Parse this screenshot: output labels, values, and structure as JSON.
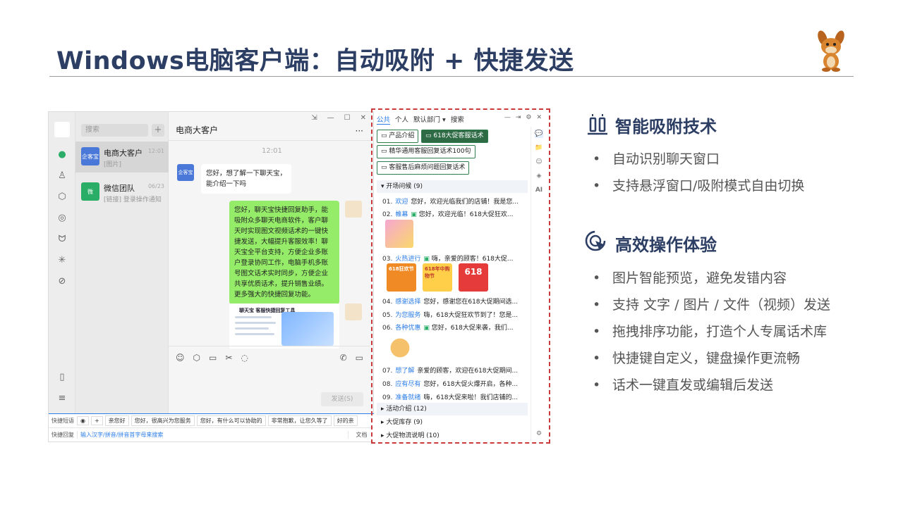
{
  "title": "Windows电脑客户端：自动吸附 + 快捷发送",
  "chat_window": {
    "search_placeholder": "搜索",
    "plus": "+",
    "conversations": [
      {
        "avatar": "企客宝",
        "name": "电商大客户",
        "time": "12:01",
        "preview": "[图片]",
        "color": "#4a78d8"
      },
      {
        "avatar": "微",
        "name": "微信团队",
        "time": "06/23",
        "preview": "[链接] 登录操作通知",
        "color": "#2aae67"
      }
    ],
    "header_title": "电商大客户",
    "more": "···",
    "window_buttons": [
      "⇲",
      "—",
      "☐",
      "✕"
    ],
    "timestamp": "12:01",
    "incoming_avatar": "企客宝",
    "incoming_message": "您好，想了解一下聊天宝，能介绍一下吗",
    "outgoing_message": "您好，聊天宝快捷回复助手，能吸附众多聊天电商软件，客户聊天时实现图文视频话术的一键快捷发送，大幅提升客服效率！聊天宝全平台支持，方便企业多账户登录协同工作，电脑手机多账号图文话术实时同步，方便企业共享优质话术，提升销售业绩。更多强大的快捷回复功能。",
    "image_message_title": "聊天宝 客服快捷回复工具",
    "send_button": "发送(S)",
    "quickbar_label": "快捷短语",
    "quick_chips": [
      "亲您好",
      "您好，很高兴为您服务",
      "您好，有什么可以协助的",
      "非常抱歉，让您久等了",
      "好的亲"
    ],
    "quickreply_label": "快捷回复",
    "quickreply_placeholder": "输入汉字/拼音/拼音首字母来搜索",
    "doc_button": "文档"
  },
  "panel": {
    "tabs": [
      "公共",
      "个人",
      "默认部门 ▾",
      "搜索"
    ],
    "active_tab": "公共",
    "folders": [
      "产品介绍",
      "618大促客服话术",
      "精华通用客服回复话术100句",
      "客服售后麻烦问题回复话术"
    ],
    "group_open": "开场问候  (9)",
    "rows": [
      {
        "num": "01.",
        "key": "欢迎",
        "text": "您好，欢迎光临我们的店铺！我是您..."
      },
      {
        "num": "02.",
        "key": "帷幕",
        "text": "您好，欢迎光临！618大促狂欢..."
      },
      {
        "num": "03.",
        "key": "火热进行",
        "text": "嗨，亲爱的顾客！618大促..."
      },
      {
        "num": "04.",
        "key": "感谢选择",
        "text": "您好，感谢您在618大促期间选..."
      },
      {
        "num": "05.",
        "key": "为您服务",
        "text": "嗨，618大促狂欢节到了！您是..."
      },
      {
        "num": "06.",
        "key": "各种优惠",
        "text": "您好，618大促来袭，我们..."
      },
      {
        "num": "07.",
        "key": "想了解",
        "text": "亲爱的顾客，欢迎在618大促期间..."
      },
      {
        "num": "08.",
        "key": "应有尽有",
        "text": "您好，618大促火爆开启，各种..."
      },
      {
        "num": "09.",
        "key": "准备就绪",
        "text": "嗨，618大促来啦！我们店铺的..."
      }
    ],
    "thumb_labels": [
      "618狂欢节",
      "618年中购物节",
      "618"
    ],
    "groups_closed": [
      "活动介绍  (12)",
      "大促库存  (9)",
      "大促物流说明  (10)"
    ],
    "side_icons": [
      "💬",
      "📁",
      "☺",
      "◈",
      "AI",
      "⚙"
    ]
  },
  "sections": [
    {
      "title": "智能吸附技术",
      "bullets": [
        "自动识别聊天窗口",
        "支持悬浮窗口/吸附模式自由切换"
      ]
    },
    {
      "title": "高效操作体验",
      "bullets": [
        "图片智能预览，避免发错内容",
        "支持 文字 / 图片 / 文件（视频）发送",
        "拖拽排序功能，打造个人专属话术库",
        "快捷键自定义，键盘操作更流畅",
        "话术一键直发或编辑后发送"
      ]
    }
  ],
  "colors": {
    "title": "#2c3e63",
    "accent_red": "#cc3b3b",
    "wechat_green": "#95ec69",
    "link_blue": "#2b7de9"
  }
}
